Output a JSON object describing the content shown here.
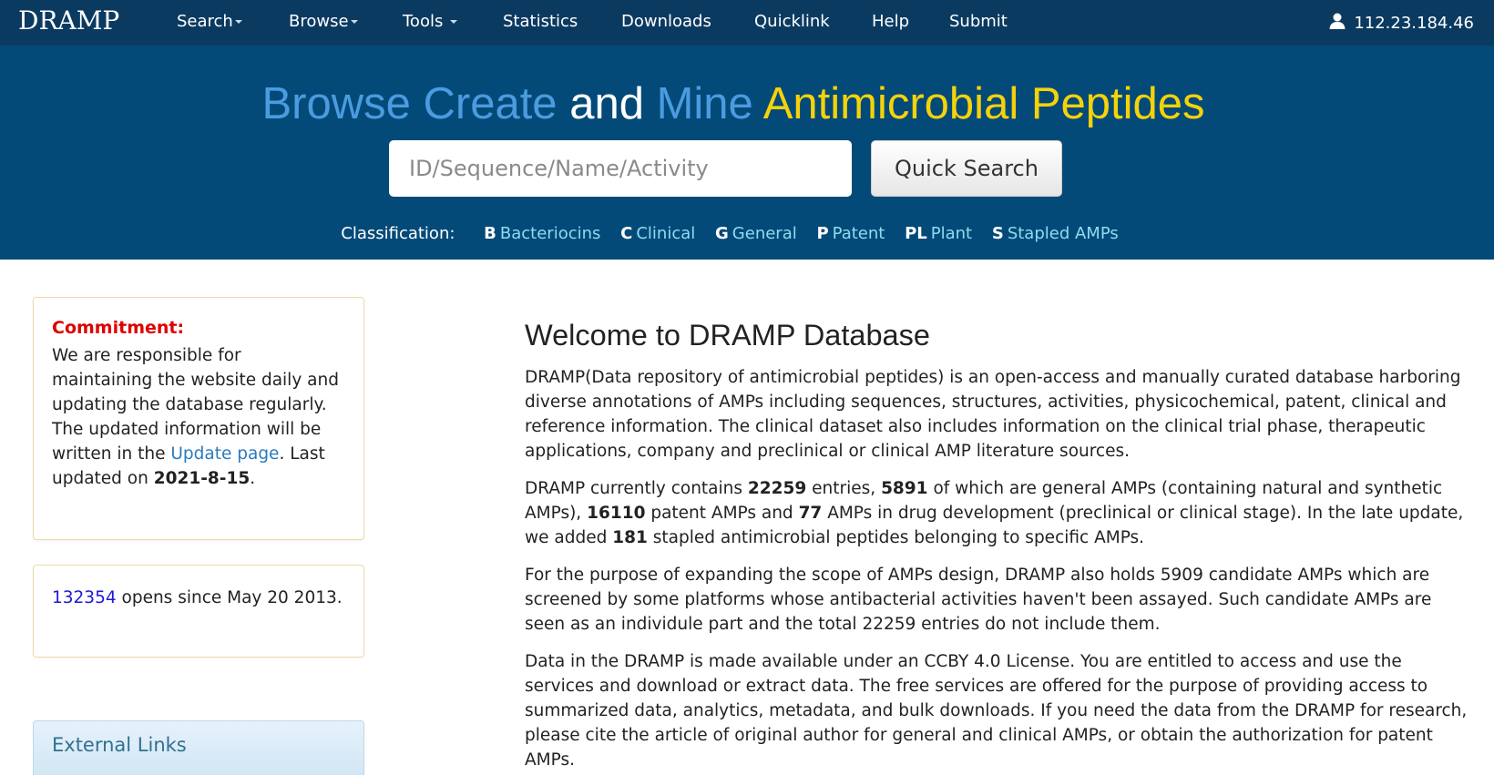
{
  "nav": {
    "brand": "DRAMP",
    "items": [
      {
        "label": "Search",
        "dropdown": true
      },
      {
        "label": "Browse",
        "dropdown": true
      },
      {
        "label": "Tools",
        "dropdown": true
      },
      {
        "label": "Statistics",
        "dropdown": false
      },
      {
        "label": "Downloads",
        "dropdown": false
      },
      {
        "label": "Quicklink",
        "dropdown": false
      },
      {
        "label": "Help",
        "dropdown": false
      },
      {
        "label": "Submit",
        "dropdown": false
      }
    ],
    "user_ip": "112.23.184.46",
    "user_icon": "user-icon"
  },
  "hero": {
    "title_parts": [
      "Browse Create",
      "and",
      "Mine",
      "Antimicrobial Peptides"
    ],
    "search_placeholder": "ID/Sequence/Name/Activity",
    "search_button": "Quick Search",
    "classification_label": "Classification:",
    "classes": [
      {
        "code": "B",
        "name": "Bacteriocins"
      },
      {
        "code": "C",
        "name": "Clinical"
      },
      {
        "code": "G",
        "name": "General"
      },
      {
        "code": "P",
        "name": "Patent"
      },
      {
        "code": "PL",
        "name": "Plant"
      },
      {
        "code": "S",
        "name": "Stapled AMPs"
      }
    ]
  },
  "sidebar": {
    "commitment_heading": "Commitment:",
    "commitment_text_1": "We are responsible for maintaining the website daily and updating the database regularly. The updated information will be written in the ",
    "update_link": "Update page",
    "commitment_text_2": ". Last updated on ",
    "last_updated": "2021-8-15",
    "commitment_text_3": ".",
    "visit_count": "132354",
    "visit_text": " opens since May 20 2013.",
    "external_links_heading": "External Links"
  },
  "main": {
    "welcome_title": "Welcome to DRAMP Database",
    "p1": "DRAMP(Data repository of antimicrobial peptides) is an open-access and manually curated database harboring diverse annotations of AMPs including sequences, structures, activities, physicochemical, patent, clinical and reference information. The clinical dataset also includes information on the clinical trial phase, therapeutic applications, company and preclinical or clinical AMP literature sources.",
    "p2": {
      "t1": "DRAMP currently contains ",
      "total": "22259",
      "t2": " entries, ",
      "general": "5891",
      "t3": " of which are general AMPs (containing natural and synthetic AMPs), ",
      "patent": "16110",
      "t4": " patent AMPs and ",
      "drug": "77",
      "t5": " AMPs in drug development (preclinical or clinical stage). In the late update, we added ",
      "stapled": "181",
      "t6": " stapled antimicrobial peptides belonging to specific AMPs."
    },
    "p3": "For the purpose of expanding the scope of AMPs design, DRAMP also holds 5909 candidate AMPs which are screened by some platforms whose antibacterial activities haven't been assayed. Such candidate AMPs are seen as an individule part and the total 22259 entries do not include them.",
    "p4": "Data in the DRAMP is made available under an CCBY 4.0 License. You are entitled to access and use the services and download or extract data. The free services are offered for the purpose of providing access to summarized data, analytics, metadata, and bulk downloads. If you need the data from the DRAMP for research, please cite the article of original author for general and clinical AMPs, or obtain the authorization for patent AMPs."
  }
}
